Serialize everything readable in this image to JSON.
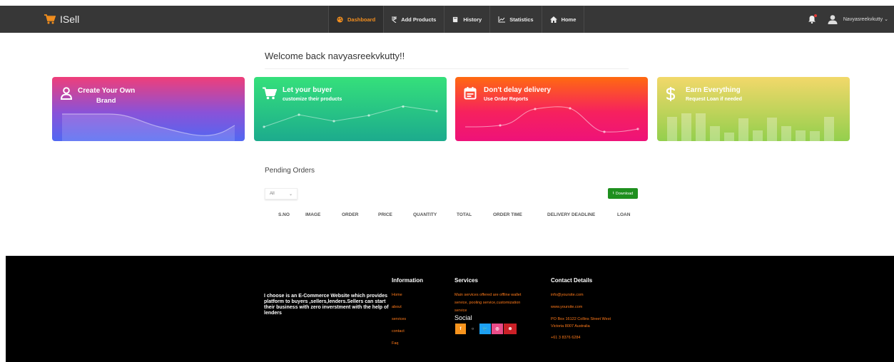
{
  "brand": {
    "name": "ISell"
  },
  "nav": {
    "items": [
      {
        "label": "Dashboard",
        "icon": "palette-icon"
      },
      {
        "label": "Add Products",
        "icon": "rupee-icon"
      },
      {
        "label": "History",
        "icon": "book-icon"
      },
      {
        "label": "Statistics",
        "icon": "chart-line-icon"
      },
      {
        "label": "Home",
        "icon": "home-icon"
      }
    ],
    "user": "Navyasreekvkutty",
    "caret": "⌄"
  },
  "welcome": "Welcome back navyasreekvkutty!!",
  "cards": [
    {
      "title": "Create Your Own",
      "subtitle": "Brand"
    },
    {
      "title": "Let your buyer",
      "subtitle": "customize their products"
    },
    {
      "title": "Don't delay delivery",
      "subtitle": "Use Order Reports"
    },
    {
      "title": "Earn Everything",
      "subtitle": "Request Loan if needed"
    }
  ],
  "orders": {
    "title": "Pending Orders",
    "filter_value": "All",
    "filter_caret": "⌄",
    "download_label": "Download",
    "download_icon": "⭳",
    "columns": [
      "S.NO",
      "IMAGE",
      "ORDER",
      "PRICE",
      "QUANTITY",
      "TOTAL",
      "ORDER TIME",
      "DELIVERY DEADLINE",
      "LOAN"
    ]
  },
  "footer": {
    "about": "I choose is an E-Commerce Website which provides platform to buyers ,sellers,lenders.Sellers can start their business with zero inverstment with the help of lenders",
    "information": {
      "heading": "Information",
      "links": [
        "Home",
        "about",
        "services",
        "contact",
        "Faq"
      ]
    },
    "services": {
      "heading": "Services",
      "lines": [
        "Main services offered are offline wallet",
        "service, pooling service,customization",
        "service"
      ]
    },
    "social": {
      "heading": "Social",
      "buttons": [
        {
          "glyph": "f",
          "color": "#f7941d"
        },
        {
          "glyph": "○",
          "color": "#000000"
        },
        {
          "glyph": "🐦",
          "color": "#1da1f2"
        },
        {
          "glyph": "◎",
          "color": "#ea4c89"
        },
        {
          "glyph": "⊛",
          "color": "#cb2027"
        }
      ]
    },
    "contact": {
      "heading": "Contact Details",
      "email": "info@yoursite.com",
      "website": "www.yoursite.com",
      "address1": "PO Box 16122 Collins Street West",
      "address2": "Victoria 8007 Australia",
      "phone": "+61 3 8376 6284"
    }
  },
  "colors": {
    "accent": "#f28e1e",
    "navbar": "#373737",
    "footer": "#000000",
    "download": "#1e8f1e",
    "link": "#ff7a1a"
  }
}
